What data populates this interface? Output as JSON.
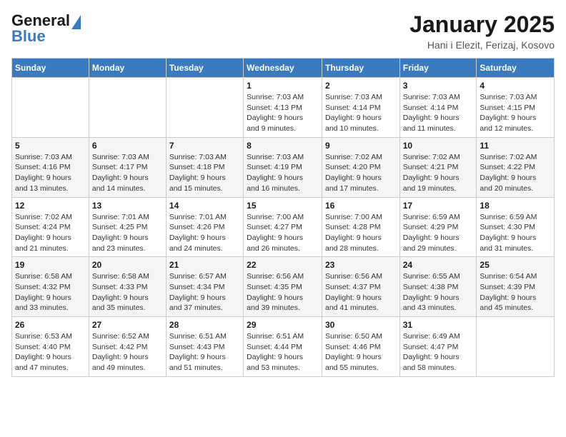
{
  "header": {
    "logo_line1": "General",
    "logo_line2": "Blue",
    "title": "January 2025",
    "subtitle": "Hani i Elezit, Ferizaj, Kosovo"
  },
  "weekdays": [
    "Sunday",
    "Monday",
    "Tuesday",
    "Wednesday",
    "Thursday",
    "Friday",
    "Saturday"
  ],
  "weeks": [
    [
      {
        "day": "",
        "info": ""
      },
      {
        "day": "",
        "info": ""
      },
      {
        "day": "",
        "info": ""
      },
      {
        "day": "1",
        "info": "Sunrise: 7:03 AM\nSunset: 4:13 PM\nDaylight: 9 hours\nand 9 minutes."
      },
      {
        "day": "2",
        "info": "Sunrise: 7:03 AM\nSunset: 4:14 PM\nDaylight: 9 hours\nand 10 minutes."
      },
      {
        "day": "3",
        "info": "Sunrise: 7:03 AM\nSunset: 4:14 PM\nDaylight: 9 hours\nand 11 minutes."
      },
      {
        "day": "4",
        "info": "Sunrise: 7:03 AM\nSunset: 4:15 PM\nDaylight: 9 hours\nand 12 minutes."
      }
    ],
    [
      {
        "day": "5",
        "info": "Sunrise: 7:03 AM\nSunset: 4:16 PM\nDaylight: 9 hours\nand 13 minutes."
      },
      {
        "day": "6",
        "info": "Sunrise: 7:03 AM\nSunset: 4:17 PM\nDaylight: 9 hours\nand 14 minutes."
      },
      {
        "day": "7",
        "info": "Sunrise: 7:03 AM\nSunset: 4:18 PM\nDaylight: 9 hours\nand 15 minutes."
      },
      {
        "day": "8",
        "info": "Sunrise: 7:03 AM\nSunset: 4:19 PM\nDaylight: 9 hours\nand 16 minutes."
      },
      {
        "day": "9",
        "info": "Sunrise: 7:02 AM\nSunset: 4:20 PM\nDaylight: 9 hours\nand 17 minutes."
      },
      {
        "day": "10",
        "info": "Sunrise: 7:02 AM\nSunset: 4:21 PM\nDaylight: 9 hours\nand 19 minutes."
      },
      {
        "day": "11",
        "info": "Sunrise: 7:02 AM\nSunset: 4:22 PM\nDaylight: 9 hours\nand 20 minutes."
      }
    ],
    [
      {
        "day": "12",
        "info": "Sunrise: 7:02 AM\nSunset: 4:24 PM\nDaylight: 9 hours\nand 21 minutes."
      },
      {
        "day": "13",
        "info": "Sunrise: 7:01 AM\nSunset: 4:25 PM\nDaylight: 9 hours\nand 23 minutes."
      },
      {
        "day": "14",
        "info": "Sunrise: 7:01 AM\nSunset: 4:26 PM\nDaylight: 9 hours\nand 24 minutes."
      },
      {
        "day": "15",
        "info": "Sunrise: 7:00 AM\nSunset: 4:27 PM\nDaylight: 9 hours\nand 26 minutes."
      },
      {
        "day": "16",
        "info": "Sunrise: 7:00 AM\nSunset: 4:28 PM\nDaylight: 9 hours\nand 28 minutes."
      },
      {
        "day": "17",
        "info": "Sunrise: 6:59 AM\nSunset: 4:29 PM\nDaylight: 9 hours\nand 29 minutes."
      },
      {
        "day": "18",
        "info": "Sunrise: 6:59 AM\nSunset: 4:30 PM\nDaylight: 9 hours\nand 31 minutes."
      }
    ],
    [
      {
        "day": "19",
        "info": "Sunrise: 6:58 AM\nSunset: 4:32 PM\nDaylight: 9 hours\nand 33 minutes."
      },
      {
        "day": "20",
        "info": "Sunrise: 6:58 AM\nSunset: 4:33 PM\nDaylight: 9 hours\nand 35 minutes."
      },
      {
        "day": "21",
        "info": "Sunrise: 6:57 AM\nSunset: 4:34 PM\nDaylight: 9 hours\nand 37 minutes."
      },
      {
        "day": "22",
        "info": "Sunrise: 6:56 AM\nSunset: 4:35 PM\nDaylight: 9 hours\nand 39 minutes."
      },
      {
        "day": "23",
        "info": "Sunrise: 6:56 AM\nSunset: 4:37 PM\nDaylight: 9 hours\nand 41 minutes."
      },
      {
        "day": "24",
        "info": "Sunrise: 6:55 AM\nSunset: 4:38 PM\nDaylight: 9 hours\nand 43 minutes."
      },
      {
        "day": "25",
        "info": "Sunrise: 6:54 AM\nSunset: 4:39 PM\nDaylight: 9 hours\nand 45 minutes."
      }
    ],
    [
      {
        "day": "26",
        "info": "Sunrise: 6:53 AM\nSunset: 4:40 PM\nDaylight: 9 hours\nand 47 minutes."
      },
      {
        "day": "27",
        "info": "Sunrise: 6:52 AM\nSunset: 4:42 PM\nDaylight: 9 hours\nand 49 minutes."
      },
      {
        "day": "28",
        "info": "Sunrise: 6:51 AM\nSunset: 4:43 PM\nDaylight: 9 hours\nand 51 minutes."
      },
      {
        "day": "29",
        "info": "Sunrise: 6:51 AM\nSunset: 4:44 PM\nDaylight: 9 hours\nand 53 minutes."
      },
      {
        "day": "30",
        "info": "Sunrise: 6:50 AM\nSunset: 4:46 PM\nDaylight: 9 hours\nand 55 minutes."
      },
      {
        "day": "31",
        "info": "Sunrise: 6:49 AM\nSunset: 4:47 PM\nDaylight: 9 hours\nand 58 minutes."
      },
      {
        "day": "",
        "info": ""
      }
    ]
  ]
}
